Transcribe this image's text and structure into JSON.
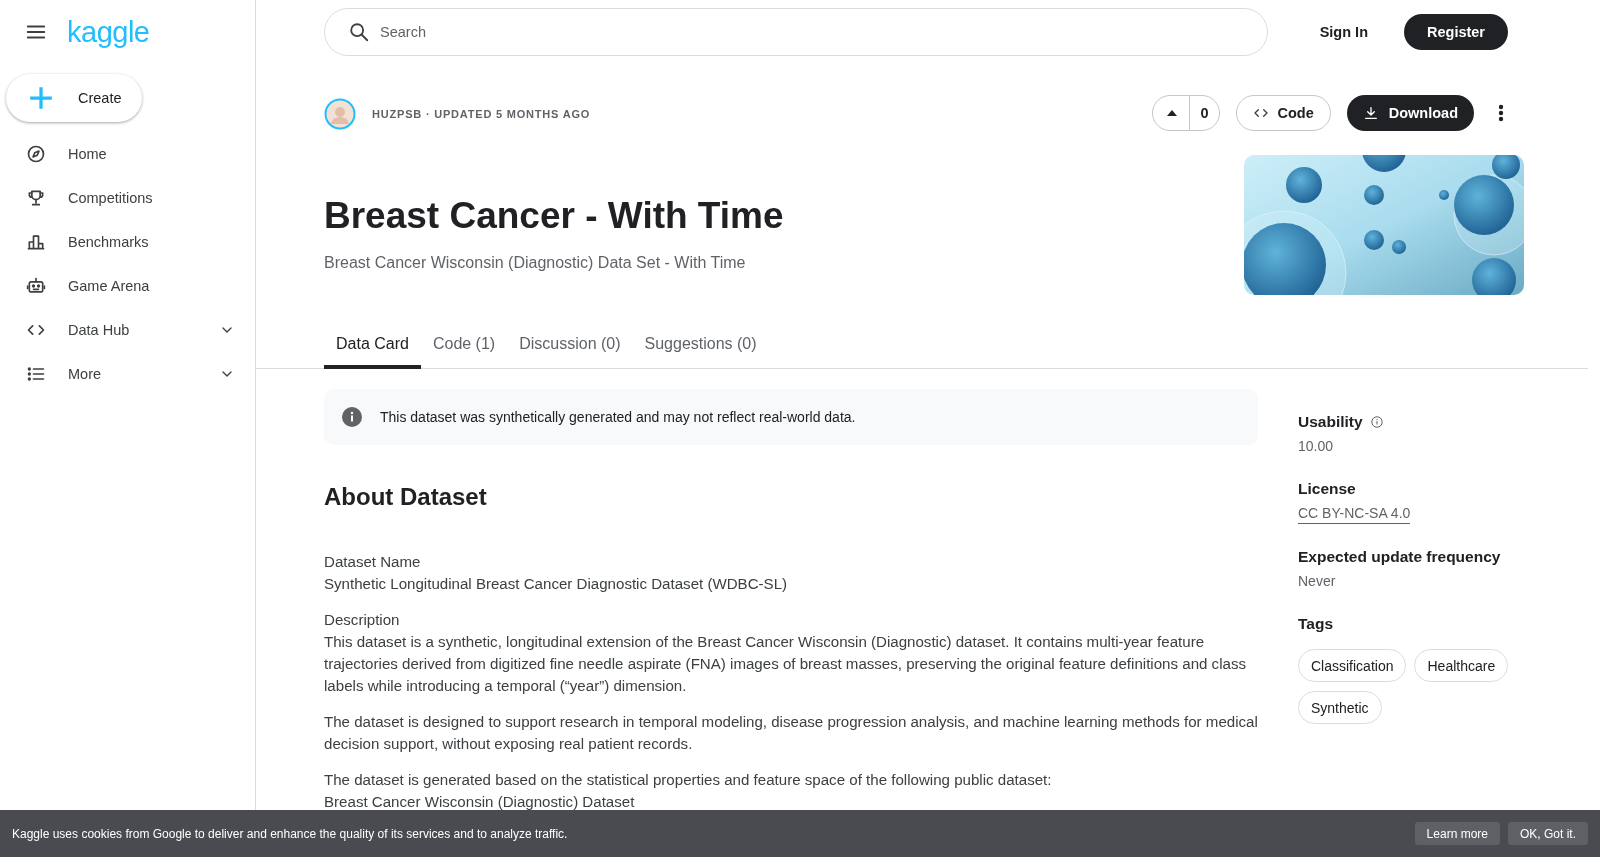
{
  "sidebar": {
    "logo": "kaggle",
    "create_button": "Create",
    "items": [
      {
        "label": "Home",
        "expandable": false
      },
      {
        "label": "Competitions",
        "expandable": false
      },
      {
        "label": "Benchmarks",
        "expandable": false
      },
      {
        "label": "Game Arena",
        "expandable": false
      },
      {
        "label": "Data Hub",
        "expandable": true
      },
      {
        "label": "More",
        "expandable": true
      }
    ]
  },
  "header": {
    "search": {
      "placeholder": "Search"
    },
    "sign_in": "Sign In",
    "register": "Register"
  },
  "dataset": {
    "meta": "HUZPSB · UPDATED 5 MONTHS AGO",
    "upvotes": "0",
    "code_button": "Code",
    "download_button": "Download",
    "title": "Breast Cancer - With Time",
    "subtitle": "Breast Cancer Wisconsin (Diagnostic) Data Set - With Time"
  },
  "tabs": [
    {
      "label": "Data Card",
      "selected": true
    },
    {
      "label": "Code (1)",
      "selected": false
    },
    {
      "label": "Discussion (0)",
      "selected": false
    },
    {
      "label": "Suggestions (0)",
      "selected": false
    }
  ],
  "notice": "This dataset was synthetically generated and may not reflect real-world data.",
  "about": {
    "heading": "About Dataset",
    "blocks": [
      {
        "lines": [
          "Dataset Name",
          "Synthetic Longitudinal Breast Cancer Diagnostic Dataset (WDBC-SL)"
        ]
      },
      {
        "lines": [
          "Description",
          "This dataset is a synthetic, longitudinal extension of the Breast Cancer Wisconsin (Diagnostic) dataset. It contains multi-year feature trajectories derived from digitized fine needle aspirate (FNA) images of breast masses, preserving the original feature definitions and class labels while introducing a temporal (“year”) dimension."
        ]
      },
      {
        "lines": [
          "The dataset is designed to support research in temporal modeling, disease progression analysis, and machine learning methods for medical decision support, without exposing real patient records."
        ]
      },
      {
        "lines": [
          "The dataset is generated based on the statistical properties and feature space of the following public dataset:",
          "Breast Cancer Wisconsin (Diagnostic) Dataset"
        ]
      }
    ]
  },
  "details": {
    "usability": {
      "label": "Usability",
      "value": "10.00"
    },
    "license": {
      "label": "License",
      "value": "CC BY-NC-SA 4.0"
    },
    "update_frequency": {
      "label": "Expected update frequency",
      "value": "Never"
    },
    "tags": {
      "label": "Tags",
      "items": [
        "Classification",
        "Healthcare",
        "Synthetic"
      ]
    }
  },
  "cookie_bar": {
    "text": "Kaggle uses cookies from Google to deliver and enhance the quality of its services and to analyze traffic.",
    "buttons": [
      "Learn more",
      "OK, Got it."
    ]
  }
}
